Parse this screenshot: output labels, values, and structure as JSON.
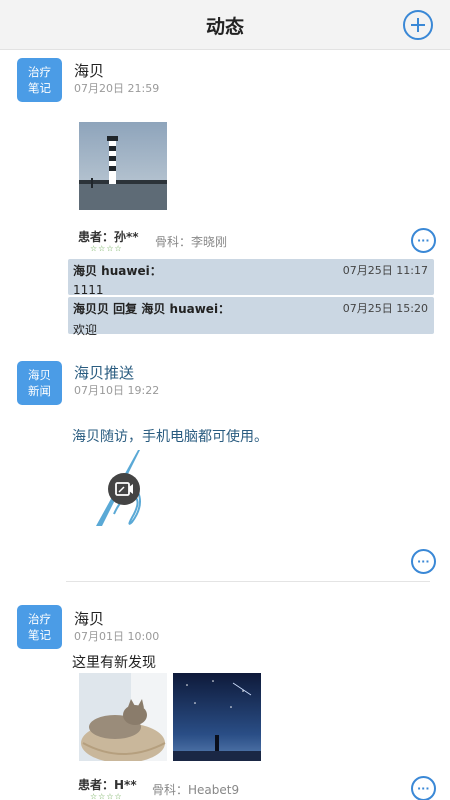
{
  "navbar": {
    "title": "动态",
    "add_icon": "plus-circle-icon",
    "accent": "#3a88d6"
  },
  "posts": [
    {
      "badge": [
        "治疗",
        "笔记"
      ],
      "author": "海贝",
      "time": "07月20日 21:59",
      "images": [
        "lighthouse-photo"
      ],
      "patient_label": "患者：孙**",
      "rating": "☆☆☆☆",
      "department": "骨科：李晓刚",
      "replies": [
        {
          "header": "海贝 huawei：",
          "time": "07月25日 11:17",
          "body": "1111"
        },
        {
          "header": "海贝贝 回复 海贝 huawei：",
          "time": "07月25日 15:20",
          "body": "欢迎"
        }
      ]
    },
    {
      "badge": [
        "海贝",
        "新闻"
      ],
      "author": "海贝推送",
      "time": "07月10日 19:22",
      "content": "海贝随访，手机电脑都可使用。",
      "images": [
        "video-thumbnail"
      ]
    },
    {
      "badge": [
        "治疗",
        "笔记"
      ],
      "author": "海贝",
      "time": "07月01日 10:00",
      "content": "这里有新发现",
      "images": [
        "cat-photo",
        "night-sky-photo"
      ],
      "patient_label": "患者：H**",
      "rating": "☆☆☆☆",
      "department": "骨科：Heabet9"
    }
  ],
  "colors": {
    "badge": "#4b9ce6",
    "reply_bg": "#cbd7e3",
    "link_blue": "#2a5c80"
  }
}
